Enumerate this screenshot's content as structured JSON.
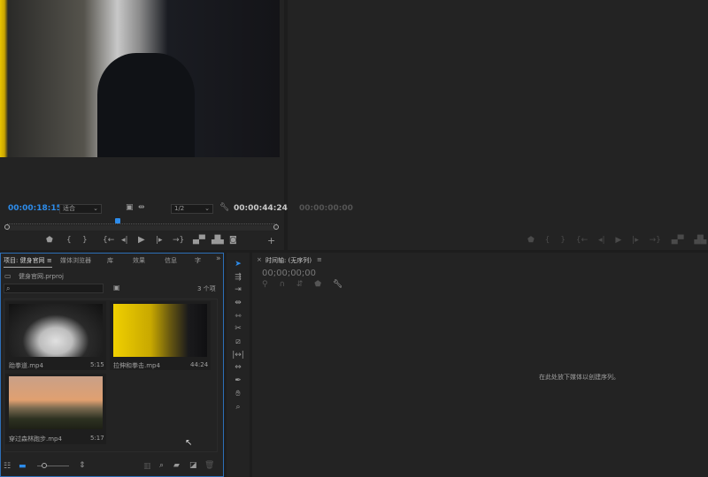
{
  "source_monitor": {
    "current_time": "00:00:18:15",
    "fit": "适合",
    "resolution": "1/2",
    "duration": "00:00:44:24",
    "playhead_fraction": 0.41,
    "controls": [
      "marker-icon",
      "mark-in-icon",
      "mark-out-icon",
      "go-to-in-icon",
      "step-back-icon",
      "play-icon",
      "step-forward-icon",
      "go-to-out-icon",
      "insert-icon",
      "overwrite-icon",
      "camera-icon",
      "add-icon"
    ]
  },
  "program_monitor": {
    "current_time": "00:00:00:00"
  },
  "project": {
    "tabs": [
      "项目: 健身官网",
      "媒体浏览器",
      "库",
      "效果",
      "信息",
      "字"
    ],
    "menu_icon": "≡",
    "more": "»",
    "file": "健身官网.prproj",
    "search_placeholder": "",
    "item_count": "3 个项",
    "clips": [
      {
        "name": "跆拳道.mp4",
        "duration": "5:15"
      },
      {
        "name": "拉伸和拳击.mp4",
        "duration": "44:24"
      },
      {
        "name": "穿过森林跑步.mp4",
        "duration": "5:17"
      }
    ]
  },
  "timeline": {
    "title": "时间轴: (无序列)",
    "menu_icon": "≡",
    "close": "×",
    "timecode": "00;00;00;00",
    "empty_message": "在此处放下媒体以创建序列。"
  },
  "colors": {
    "accent": "#2d8ceb",
    "background": "#1d1d1d"
  }
}
